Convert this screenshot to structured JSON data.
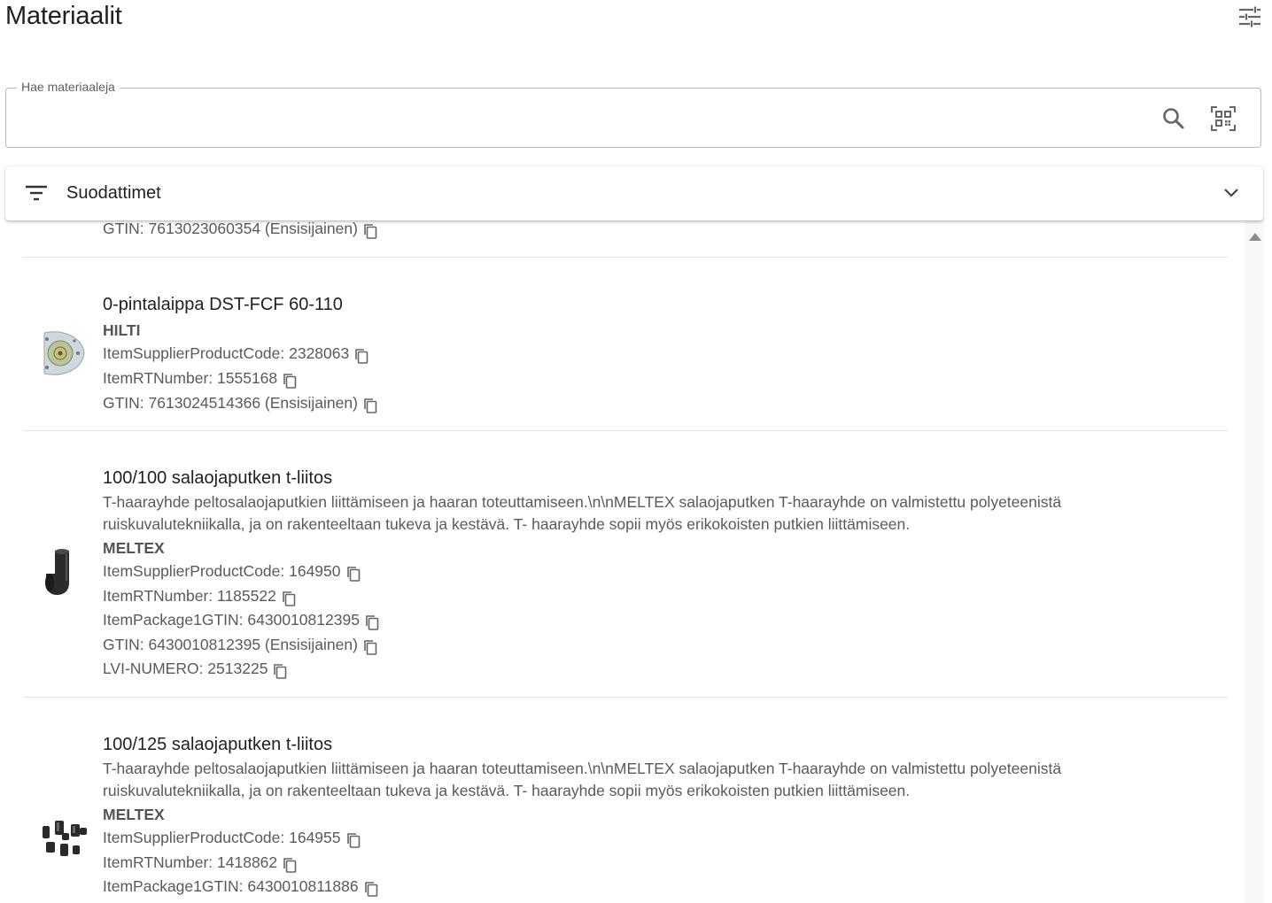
{
  "page": {
    "title": "Materiaalit"
  },
  "search": {
    "label": "Hae materiaaleja",
    "value": "",
    "placeholder": ""
  },
  "filters": {
    "label": "Suodattimet"
  },
  "partial_row": {
    "text": "GTIN: 7613023060354 (Ensisijainen)"
  },
  "items": [
    {
      "title": "0-pintalaippa DST-FCF 60-110",
      "brand": "HILTI",
      "attrs": [
        "ItemSupplierProductCode: 2328063",
        "ItemRTNumber: 1555168",
        "GTIN: 7613024514366 (Ensisijainen)"
      ]
    },
    {
      "title": "100/100 salaojaputken t-liitos",
      "description": "T-haarayhde peltosalaojaputkien liittämiseen ja haaran toteuttamiseen.\\n\\nMELTEX salaojaputken T-haarayhde on valmistettu polyeteenistä ruiskuvalutekniikalla, ja on rakenteeltaan tukeva ja kestävä. T- haarayhde sopii myös erikokoisten putkien liittämiseen.",
      "brand": "MELTEX",
      "attrs": [
        "ItemSupplierProductCode: 164950",
        "ItemRTNumber: 1185522",
        "ItemPackage1GTIN: 6430010812395",
        "GTIN: 6430010812395 (Ensisijainen)",
        "LVI-NUMERO: 2513225"
      ]
    },
    {
      "title": "100/125 salaojaputken t-liitos",
      "description": "T-haarayhde peltosalaojaputkien liittämiseen ja haaran toteuttamiseen.\\n\\nMELTEX salaojaputken T-haarayhde on valmistettu polyeteenistä ruiskuvalutekniikalla, ja on rakenteeltaan tukeva ja kestävä. T- haarayhde sopii myös erikokoisten putkien liittämiseen.",
      "brand": "MELTEX",
      "attrs": [
        "ItemSupplierProductCode: 164955",
        "ItemRTNumber: 1418862",
        "ItemPackage1GTIN: 6430010811886"
      ]
    }
  ],
  "icons": {
    "settings": "tune-icon",
    "search": "search-icon",
    "qr": "qr-code-scanner-icon",
    "filter": "filter-list-icon",
    "expand": "chevron-down-icon",
    "copy": "copy-icon",
    "scroll": "scroll-up-arrow-icon"
  },
  "colors": {
    "text": "#212121",
    "secondary_text": "#5a5a5a",
    "border": "#b9b9b9",
    "divider": "#e3e3e3"
  }
}
